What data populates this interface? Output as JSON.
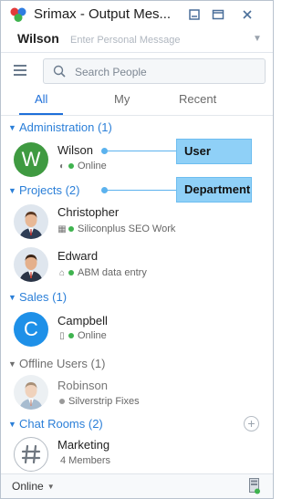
{
  "app": {
    "title": "Srimax - Output Mes..."
  },
  "user": {
    "name": "Wilson",
    "message_placeholder": "Enter Personal Message"
  },
  "search": {
    "placeholder": "Search People"
  },
  "tabs": [
    {
      "label": "All",
      "active": true
    },
    {
      "label": "My",
      "active": false
    },
    {
      "label": "Recent",
      "active": false
    }
  ],
  "groups": {
    "administration": "Administration (1)",
    "projects": "Projects (2)",
    "sales": "Sales (1)",
    "offline": "Offline Users (1)",
    "chat_rooms": "Chat Rooms (2)"
  },
  "contacts": {
    "wilson": {
      "name": "Wilson",
      "status": "Online",
      "initial": "W",
      "avatar_color": "#3f9a41"
    },
    "christopher": {
      "name": "Christopher",
      "status": "Siliconplus SEO Work"
    },
    "edward": {
      "name": "Edward",
      "status": "ABM data entry"
    },
    "campbell": {
      "name": "Campbell",
      "status": "Online",
      "initial": "C",
      "avatar_color": "#1e90e8"
    },
    "robinson": {
      "name": "Robinson",
      "status": "Silverstrip Fixes"
    }
  },
  "chat_room": {
    "name": "Marketing",
    "members": "4 Members"
  },
  "callouts": {
    "user": "User",
    "department": "Department"
  },
  "footer": {
    "status": "Online"
  },
  "colors": {
    "accent": "#1e6fd9",
    "online": "#3fb34f",
    "callout": "#8fd0f7"
  }
}
